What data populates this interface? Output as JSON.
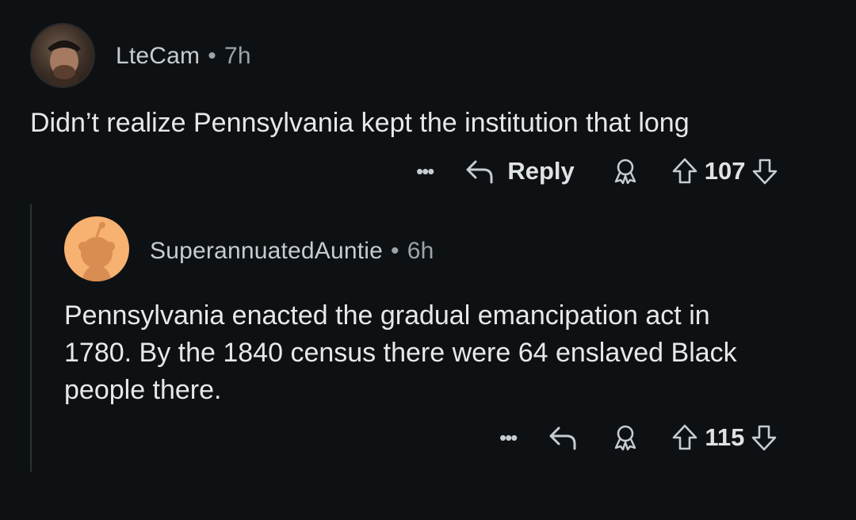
{
  "comments": [
    {
      "username": "LteCam",
      "separator": "•",
      "age": "7h",
      "body": "Didn’t realize Pennsylvania kept the institution that long",
      "more_label": "•••",
      "reply_label": "Reply",
      "score": "107"
    },
    {
      "username": "SuperannuatedAuntie",
      "separator": "•",
      "age": "6h",
      "body_lines": [
        "Pennsylvania enacted the gradual emancipation act in",
        "1780. By the 1840 census there were 64 enslaved Black",
        "people there."
      ],
      "more_label": "•••",
      "score": "115"
    }
  ],
  "colors": {
    "background": "#0e1113",
    "text": "#e6e8ea",
    "muted": "#9aa4ac",
    "avatar2_bg": "#f7b171"
  }
}
